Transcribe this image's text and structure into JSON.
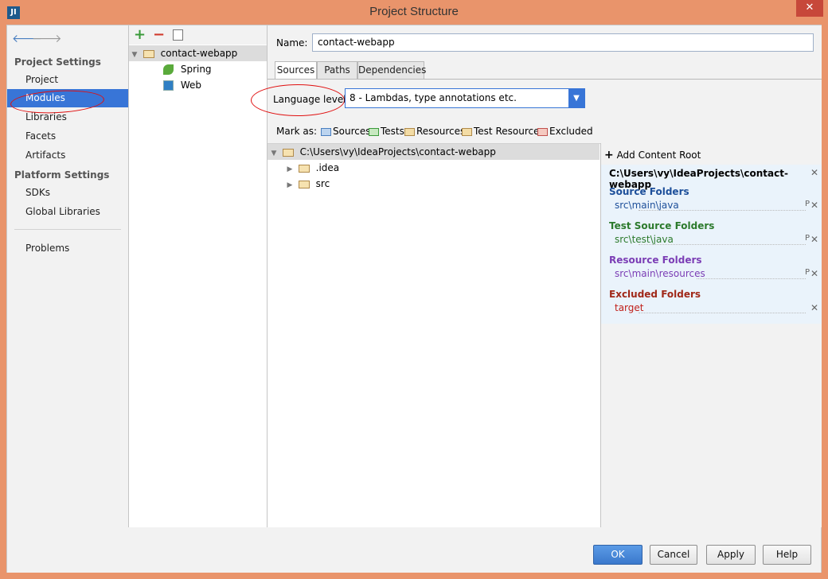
{
  "window": {
    "title": "Project Structure",
    "app_icon": "JI",
    "close": "✕"
  },
  "sidebar": {
    "back_icon": "🡐",
    "forward_icon": "🡒",
    "project_settings_title": "Project Settings",
    "platform_settings_title": "Platform Settings",
    "items": [
      {
        "label": "Project"
      },
      {
        "label": "Modules"
      },
      {
        "label": "Libraries"
      },
      {
        "label": "Facets"
      },
      {
        "label": "Artifacts"
      },
      {
        "label": "SDKs"
      },
      {
        "label": "Global Libraries"
      },
      {
        "label": "Problems"
      }
    ]
  },
  "modules": {
    "add": "+",
    "remove": "−",
    "tree": [
      {
        "label": "contact-webapp"
      },
      {
        "label": "Spring"
      },
      {
        "label": "Web"
      }
    ]
  },
  "main": {
    "name_label": "Name:",
    "name_value": "contact-webapp",
    "tabs": [
      {
        "label": "Sources"
      },
      {
        "label": "Paths"
      },
      {
        "label": "Dependencies"
      }
    ],
    "language_level_label": "Language level:",
    "language_level_value": "8 - Lambdas, type annotations etc.",
    "mark_as_label": "Mark as:",
    "mark_as": [
      {
        "label": "Sources"
      },
      {
        "label": "Tests"
      },
      {
        "label": "Resources"
      },
      {
        "label": "Test Resources"
      },
      {
        "label": "Excluded"
      }
    ],
    "tree": {
      "root": "C:\\Users\\vy\\IdeaProjects\\contact-webapp",
      "children": [
        {
          "label": ".idea"
        },
        {
          "label": "src"
        }
      ]
    },
    "content_roots": {
      "add_label": "Add Content Root",
      "root_path": "C:\\Users\\vy\\IdeaProjects\\contact-webapp",
      "groups": [
        {
          "title": "Source Folders",
          "item": "src\\main\\java",
          "color": "#1d4f9a"
        },
        {
          "title": "Test Source Folders",
          "item": "src\\test\\java",
          "color": "#2c7a2c"
        },
        {
          "title": "Resource Folders",
          "item": "src\\main\\resources",
          "color": "#7b3db5"
        },
        {
          "title": "Excluded Folders",
          "item": "target",
          "color": "#a02818"
        }
      ],
      "prop_glyph": "P",
      "remove_glyph": "✕"
    }
  },
  "buttons": {
    "ok": "OK",
    "cancel": "Cancel",
    "apply": "Apply",
    "help": "Help"
  }
}
